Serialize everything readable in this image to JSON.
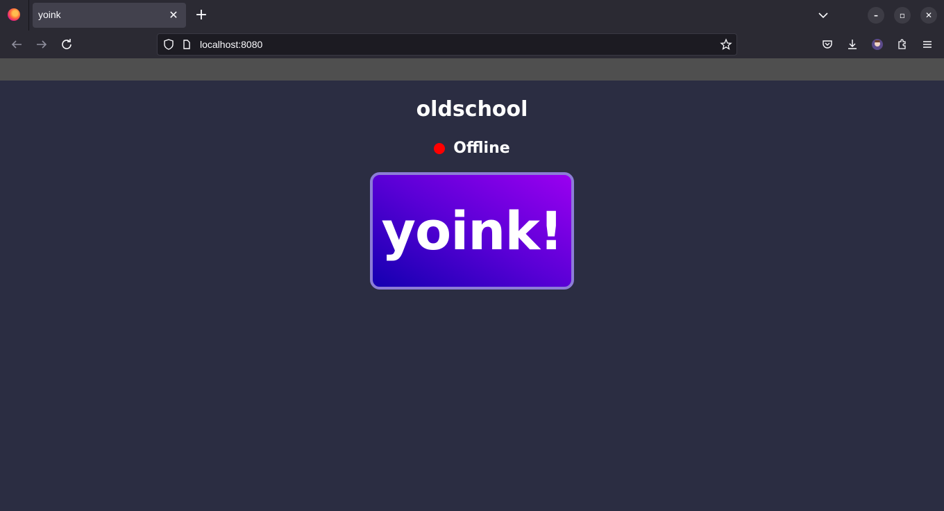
{
  "browser": {
    "tab_title": "yoink",
    "tab_close": "✕",
    "new_tab": "+",
    "url": "localhost:8080",
    "win_minimize": "–",
    "win_maximize": "▫",
    "win_close": "✕"
  },
  "page": {
    "title": "oldschool",
    "status_text": "Offline",
    "status_color": "#ff0000",
    "button_label": "yoink!"
  },
  "colors": {
    "page_background": "#2b2d42",
    "button_gradient_start": "#1400b0",
    "button_gradient_end": "#9a00f0",
    "button_border": "#8c7dd6"
  },
  "icons": [
    "firefox-logo",
    "back-arrow-icon",
    "forward-arrow-icon",
    "reload-icon",
    "shield-icon",
    "page-icon",
    "star-icon",
    "pocket-icon",
    "download-icon",
    "avatar",
    "extensions-icon",
    "menu-icon",
    "chevron-down-icon"
  ]
}
